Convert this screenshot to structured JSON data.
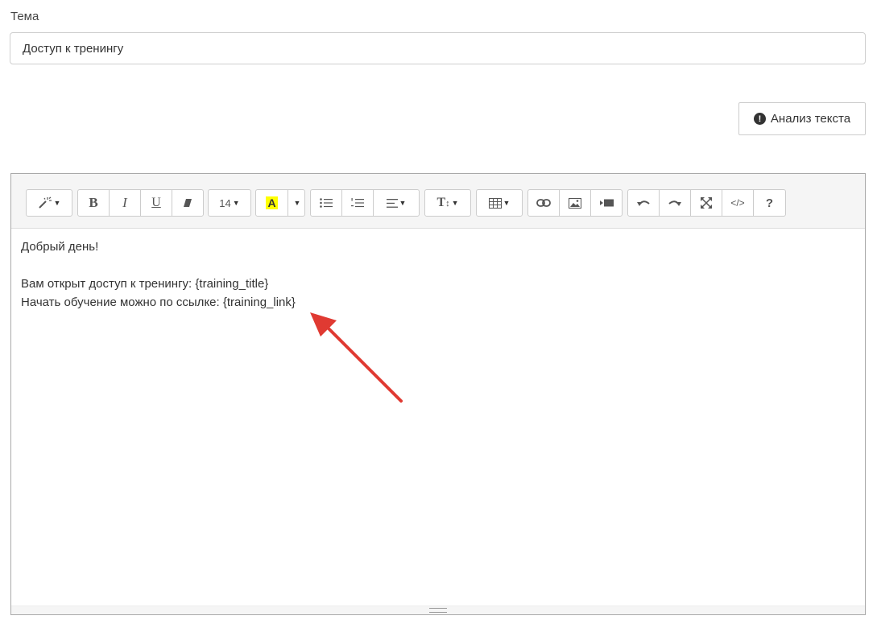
{
  "subject": {
    "label": "Тема",
    "value": "Доступ к тренингу"
  },
  "analyze_button": {
    "label": "Анализ текста",
    "icon": "exclamation-circle-icon"
  },
  "toolbar": {
    "font_size": "14",
    "highlight_letter": "A",
    "highlight_color": "#ffff00",
    "bold": "B",
    "italic": "I",
    "underline": "U",
    "help": "?",
    "code": "</>",
    "text_style": "T"
  },
  "body": {
    "lines": [
      "Добрый день!",
      "",
      "Вам открыт доступ к тренингу: {training_title}",
      "Начать обучение можно по ссылке: {training_link}"
    ]
  },
  "annotation_color": "#e03a32"
}
